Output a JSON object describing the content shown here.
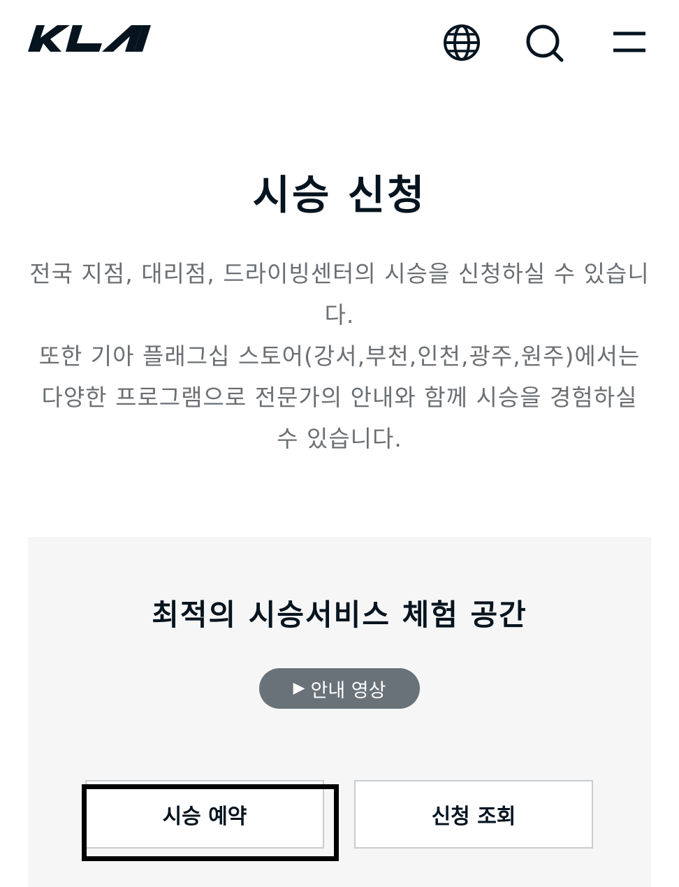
{
  "header": {
    "logo_text": "KIA",
    "icons": [
      "globe-icon",
      "search-icon",
      "menu-icon"
    ]
  },
  "main": {
    "title": "시승 신청",
    "description": [
      "전국 지점, 대리점, 드라이빙센터의 시승을 신청하실 수 있습니다.",
      "또한 기아 플래그십 스토어(강서,부천,인천,광주,원주)에서는 다양한 프로그램으로 전문가의 안내와 함께 시승을 경험하실 수 있습니다."
    ]
  },
  "panel": {
    "title": "최적의 시승서비스 체험 공간",
    "video_button": "안내 영상",
    "reserve_button": "시승 예약",
    "inquiry_button": "신청 조회"
  },
  "colors": {
    "primary_text": "#05141f",
    "secondary_text": "#6b6f73",
    "panel_bg": "#f6f6f6",
    "pill_button_bg": "#697279"
  }
}
